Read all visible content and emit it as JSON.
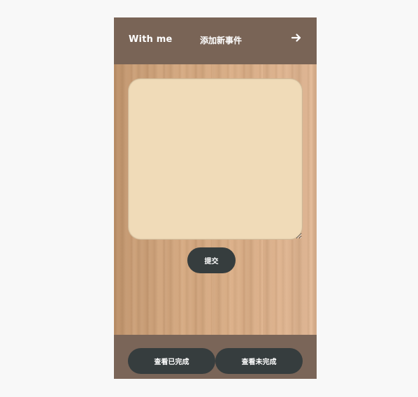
{
  "header": {
    "brand": "With me",
    "title": "添加新事件",
    "next_icon": "arrow-right-icon"
  },
  "editor": {
    "value": "",
    "placeholder": "",
    "submit_label": "提交"
  },
  "footer": {
    "view_completed_label": "查看已完成",
    "view_incomplete_label": "查看未完成"
  },
  "colors": {
    "bar": "#796456",
    "button": "#363d3e",
    "textarea": "#f0dbb8",
    "text_on_bar": "#ffffff"
  }
}
